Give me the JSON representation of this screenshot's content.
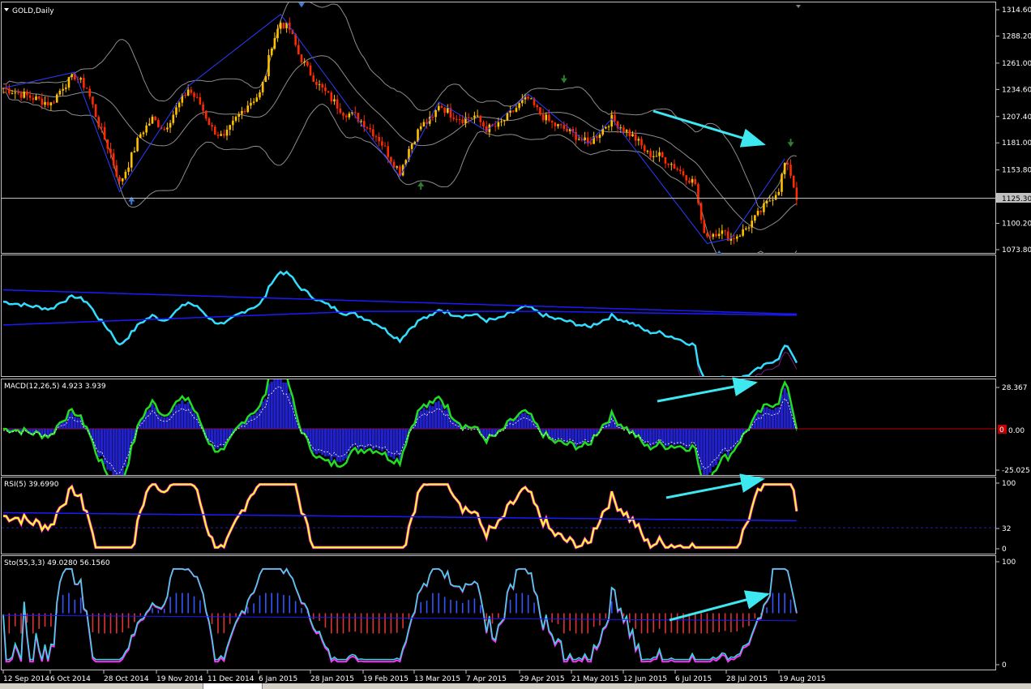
{
  "window": {
    "symbol_label": "GOLD,Daily"
  },
  "colors": {
    "background": "#000000",
    "grid_frame": "#c0c0c0",
    "bull_candle": "#ffc000",
    "bear_candle": "#ff2a00",
    "bands": "#8c8c8c",
    "zigzag": "#2b3cff",
    "arrow_cyan": "#3ee8f0",
    "up_arrow": "#3b7dd8",
    "down_arrow_green": "#2e7d32",
    "macd_line": "#22dd22",
    "macd_hist": "#2222cc",
    "rsi_line": "#ffff22",
    "rsi_overbought": "#ff00ff",
    "stoch_main": "#33dddd",
    "stoch_signal": "#ff33ff",
    "ma_blue": "#1a1aff"
  },
  "price_axis": {
    "ticks": [
      "1314.60",
      "1288.20",
      "1261.00",
      "1234.60",
      "1207.40",
      "1181.00",
      "1153.80",
      "1125.30",
      "1100.20",
      "1073.80"
    ],
    "current": "1125.30"
  },
  "x_axis": {
    "ticks": [
      "12 Sep 2014",
      "6 Oct 2014",
      "28 Oct 2014",
      "19 Nov 2014",
      "11 Dec 2014",
      "6 Jan 2015",
      "28 Jan 2015",
      "19 Feb 2015",
      "13 Mar 2015",
      "7 Apr 2015",
      "29 Apr 2015",
      "21 May 2015",
      "12 Jun 2015",
      "6 Jul 2015",
      "28 Jul 2015",
      "19 Aug 2015"
    ]
  },
  "macd": {
    "title": "MACD(12,26,5) 4.923 3.939",
    "ticks": [
      "28.367",
      "0.00",
      "-25.025"
    ],
    "marker": "0"
  },
  "rsi": {
    "title": "RSI(5) 39.6990",
    "ticks": [
      "100",
      "32",
      "0"
    ]
  },
  "stoch": {
    "title": "Sto(55,3,3) 49.0280 56.1560",
    "ticks": [
      "100",
      "0"
    ]
  },
  "chart_data": [
    {
      "type": "candlestick",
      "title": "GOLD,Daily",
      "ylim": [
        1073.8,
        1314.6
      ],
      "x_labels": [
        "12 Sep 2014",
        "6 Oct 2014",
        "28 Oct 2014",
        "19 Nov 2014",
        "11 Dec 2014",
        "6 Jan 2015",
        "28 Jan 2015",
        "19 Feb 2015",
        "13 Mar 2015",
        "7 Apr 2015",
        "29 Apr 2015",
        "21 May 2015",
        "12 Jun 2015",
        "6 Jul 2015",
        "28 Jul 2015",
        "19 Aug 2015"
      ],
      "close_path": [
        [
          0,
          1236
        ],
        [
          8,
          1228
        ],
        [
          16,
          1220
        ],
        [
          20,
          1238
        ],
        [
          24,
          1248
        ],
        [
          28,
          1236
        ],
        [
          32,
          1200
        ],
        [
          36,
          1170
        ],
        [
          39,
          1140
        ],
        [
          42,
          1160
        ],
        [
          46,
          1190
        ],
        [
          50,
          1205
        ],
        [
          54,
          1195
        ],
        [
          58,
          1215
        ],
        [
          62,
          1235
        ],
        [
          66,
          1220
        ],
        [
          70,
          1195
        ],
        [
          74,
          1185
        ],
        [
          78,
          1205
        ],
        [
          82,
          1220
        ],
        [
          86,
          1230
        ],
        [
          88,
          1250
        ],
        [
          90,
          1280
        ],
        [
          93,
          1302
        ],
        [
          96,
          1295
        ],
        [
          99,
          1270
        ],
        [
          102,
          1255
        ],
        [
          106,
          1238
        ],
        [
          110,
          1225
        ],
        [
          114,
          1212
        ],
        [
          118,
          1208
        ],
        [
          122,
          1198
        ],
        [
          126,
          1185
        ],
        [
          130,
          1165
        ],
        [
          133,
          1152
        ],
        [
          136,
          1175
        ],
        [
          140,
          1198
        ],
        [
          144,
          1205
        ],
        [
          146,
          1220
        ],
        [
          150,
          1210
        ],
        [
          154,
          1205
        ],
        [
          158,
          1208
        ],
        [
          162,
          1195
        ],
        [
          166,
          1198
        ],
        [
          170,
          1210
        ],
        [
          174,
          1222
        ],
        [
          176,
          1225
        ],
        [
          180,
          1210
        ],
        [
          184,
          1200
        ],
        [
          188,
          1195
        ],
        [
          192,
          1188
        ],
        [
          196,
          1180
        ],
        [
          200,
          1192
        ],
        [
          204,
          1205
        ],
        [
          208,
          1195
        ],
        [
          212,
          1185
        ],
        [
          216,
          1170
        ],
        [
          220,
          1168
        ],
        [
          224,
          1160
        ],
        [
          228,
          1150
        ],
        [
          232,
          1140
        ],
        [
          234,
          1100
        ],
        [
          236,
          1088
        ],
        [
          240,
          1093
        ],
        [
          244,
          1085
        ],
        [
          248,
          1092
        ],
        [
          252,
          1105
        ],
        [
          256,
          1120
        ],
        [
          260,
          1135
        ],
        [
          262,
          1160
        ],
        [
          264,
          1150
        ],
        [
          266,
          1125
        ]
      ],
      "events": {
        "tops": [
          "28 Jan 2015 area (~1314)",
          "29 Apr 2015 area (~1234)",
          "Aug 2015 (~1170)"
        ],
        "bottoms": [
          "Oct 2014 (~1130)",
          "Mar 2015 (~1145)",
          "Jul 2015 (~1073)"
        ]
      }
    },
    {
      "type": "line",
      "title": "MACD(12,26,5) 4.923 3.939",
      "ylim": [
        -25.025,
        28.367
      ],
      "values_summary": {
        "last_macd": 4.923,
        "last_signal": 3.939
      }
    },
    {
      "type": "line",
      "title": "RSI(5) 39.6990",
      "ylim": [
        0,
        100
      ],
      "last": 39.699,
      "level": 32
    },
    {
      "type": "line",
      "title": "Sto(55,3,3) 49.0280 56.1560",
      "ylim": [
        0,
        100
      ],
      "last_main": 49.028,
      "last_signal": 56.156
    }
  ]
}
